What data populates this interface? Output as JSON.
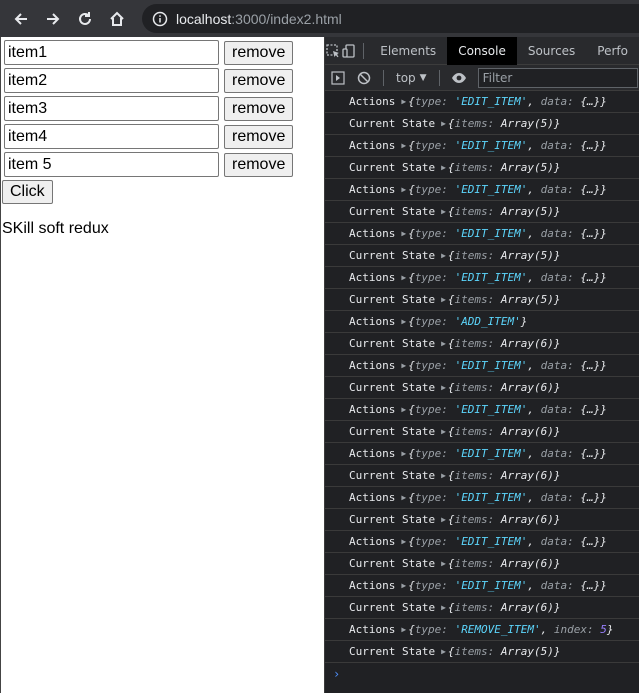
{
  "browser": {
    "url_host": "localhost",
    "url_path": ":3000/index2.html"
  },
  "page": {
    "items": [
      {
        "value": "item1",
        "button": "remove"
      },
      {
        "value": "item2",
        "button": "remove"
      },
      {
        "value": "item3",
        "button": "remove"
      },
      {
        "value": "item4",
        "button": "remove"
      },
      {
        "value": "item 5",
        "button": "remove"
      }
    ],
    "click_label": "Click",
    "text": "SKill soft redux"
  },
  "devtools": {
    "tabs": [
      "Elements",
      "Console",
      "Sources",
      "Perfo"
    ],
    "active_tab": "Console",
    "context": "top",
    "filter_placeholder": "Filter",
    "logs": [
      {
        "label": "Actions",
        "type": "EDIT_ITEM",
        "kind": "edit"
      },
      {
        "label": "Current State",
        "count": "5",
        "kind": "state"
      },
      {
        "label": "Actions",
        "type": "EDIT_ITEM",
        "kind": "edit"
      },
      {
        "label": "Current State",
        "count": "5",
        "kind": "state"
      },
      {
        "label": "Actions",
        "type": "EDIT_ITEM",
        "kind": "edit"
      },
      {
        "label": "Current State",
        "count": "5",
        "kind": "state"
      },
      {
        "label": "Actions",
        "type": "EDIT_ITEM",
        "kind": "edit"
      },
      {
        "label": "Current State",
        "count": "5",
        "kind": "state"
      },
      {
        "label": "Actions",
        "type": "EDIT_ITEM",
        "kind": "edit"
      },
      {
        "label": "Current State",
        "count": "5",
        "kind": "state"
      },
      {
        "label": "Actions",
        "type": "ADD_ITEM",
        "kind": "add"
      },
      {
        "label": "Current State",
        "count": "6",
        "kind": "state"
      },
      {
        "label": "Actions",
        "type": "EDIT_ITEM",
        "kind": "edit"
      },
      {
        "label": "Current State",
        "count": "6",
        "kind": "state"
      },
      {
        "label": "Actions",
        "type": "EDIT_ITEM",
        "kind": "edit"
      },
      {
        "label": "Current State",
        "count": "6",
        "kind": "state"
      },
      {
        "label": "Actions",
        "type": "EDIT_ITEM",
        "kind": "edit"
      },
      {
        "label": "Current State",
        "count": "6",
        "kind": "state"
      },
      {
        "label": "Actions",
        "type": "EDIT_ITEM",
        "kind": "edit"
      },
      {
        "label": "Current State",
        "count": "6",
        "kind": "state"
      },
      {
        "label": "Actions",
        "type": "EDIT_ITEM",
        "kind": "edit"
      },
      {
        "label": "Current State",
        "count": "6",
        "kind": "state"
      },
      {
        "label": "Actions",
        "type": "EDIT_ITEM",
        "kind": "edit"
      },
      {
        "label": "Current State",
        "count": "6",
        "kind": "state"
      },
      {
        "label": "Actions",
        "type": "REMOVE_ITEM",
        "index": "5",
        "kind": "remove"
      },
      {
        "label": "Current State",
        "count": "5",
        "kind": "state"
      }
    ],
    "prompt": "›"
  },
  "colors": {
    "string": "#5cd5fb",
    "number": "#9980ff",
    "devtools_bg": "#202124"
  }
}
